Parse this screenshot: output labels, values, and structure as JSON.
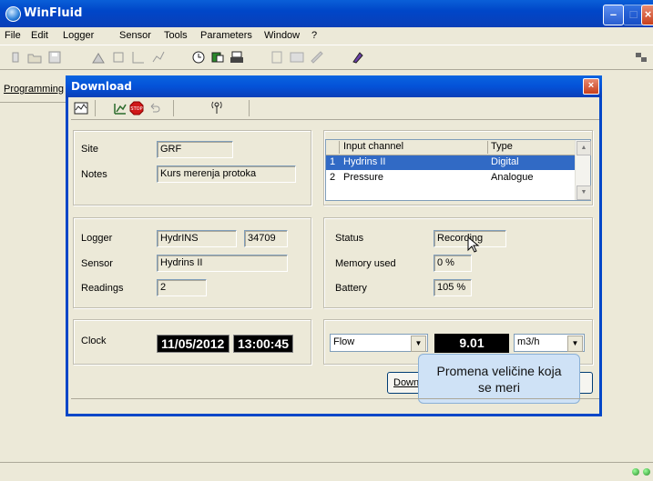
{
  "window": {
    "title": "WinFluid"
  },
  "menu": [
    {
      "label": "File"
    },
    {
      "label": "Edit"
    },
    {
      "label": "Logger"
    },
    {
      "label": "Sensor"
    },
    {
      "label": "Tools"
    },
    {
      "label": "Parameters"
    },
    {
      "label": "Window"
    },
    {
      "label": "?"
    }
  ],
  "side_tab": {
    "label": "Programming"
  },
  "dialog": {
    "title": "Download",
    "site": {
      "label": "Site",
      "value": "GRF"
    },
    "notes": {
      "label": "Notes",
      "value": "Kurs merenja protoka"
    },
    "channels": {
      "headers": [
        "",
        "Input channel",
        "Type"
      ],
      "rows": [
        {
          "num": "1",
          "name": "Hydrins II",
          "type": "Digital"
        },
        {
          "num": "2",
          "name": "Pressure",
          "type": "Analogue"
        }
      ]
    },
    "logger": {
      "label": "Logger",
      "value": "HydrINS",
      "serial": "34709"
    },
    "sensor": {
      "label": "Sensor",
      "value": "Hydrins II"
    },
    "readings": {
      "label": "Readings",
      "value": "2"
    },
    "status": {
      "label": "Status",
      "value": "Recording"
    },
    "memory": {
      "label": "Memory used",
      "value": "0 %"
    },
    "battery": {
      "label": "Battery",
      "value": "105 %"
    },
    "clock": {
      "label": "Clock",
      "date": "11/05/2012",
      "time": "13:00:45"
    },
    "measure": {
      "selected": "Flow",
      "value": "9.01",
      "unit": "m3/h"
    },
    "download_button": {
      "label": "Down"
    }
  },
  "tooltip": {
    "line1": "Promena veličine koja",
    "line2": "se meri"
  },
  "colors": {
    "titlebar": "#0046c8",
    "selection": "#316ac5",
    "tooltip": "#cfe2f6"
  }
}
